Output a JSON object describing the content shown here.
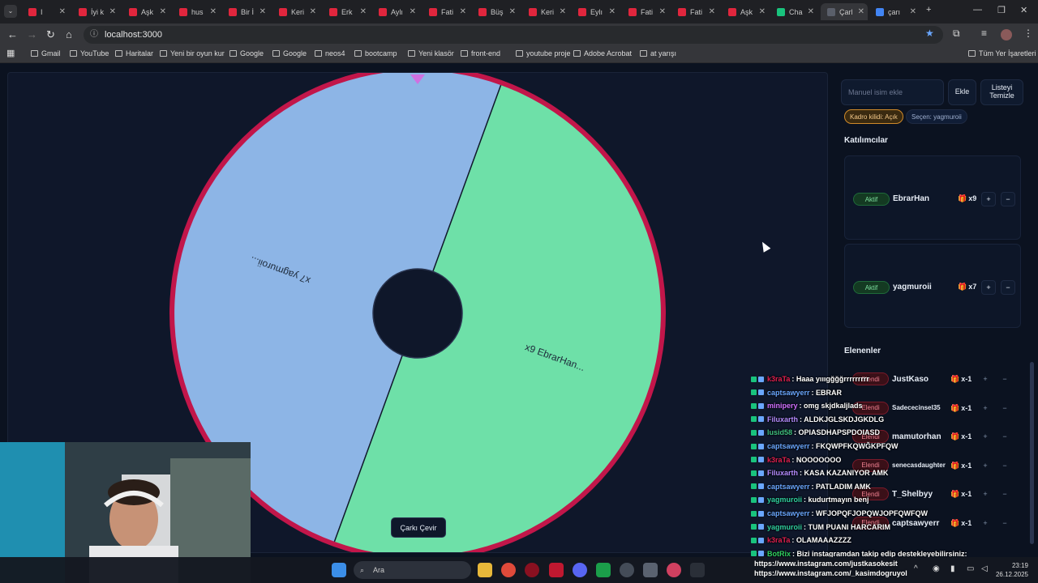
{
  "browser": {
    "tabs": [
      {
        "label": "I",
        "fav": "#e0263d"
      },
      {
        "label": "İyi k",
        "fav": "#e0263d"
      },
      {
        "label": "Aşk",
        "fav": "#e0263d"
      },
      {
        "label": "hus",
        "fav": "#e0263d"
      },
      {
        "label": "Bir İ",
        "fav": "#e0263d"
      },
      {
        "label": "Keri",
        "fav": "#e0263d"
      },
      {
        "label": "Erk",
        "fav": "#e0263d"
      },
      {
        "label": "Aylı",
        "fav": "#e0263d"
      },
      {
        "label": "Fati",
        "fav": "#e0263d"
      },
      {
        "label": "Büş",
        "fav": "#e0263d"
      },
      {
        "label": "Keri",
        "fav": "#e0263d"
      },
      {
        "label": "Eylı",
        "fav": "#e0263d"
      },
      {
        "label": "Fati",
        "fav": "#e0263d"
      },
      {
        "label": "Fati",
        "fav": "#e0263d"
      },
      {
        "label": "Aşk",
        "fav": "#e0263d"
      },
      {
        "label": "Cha",
        "fav": "#19c37d"
      },
      {
        "label": "Çarl",
        "fav": "#5a5f6a"
      },
      {
        "label": "çarı",
        "fav": "#4285f4"
      }
    ],
    "url": "localhost:3000",
    "bookmarks": [
      "Gmail",
      "YouTube",
      "Haritalar",
      "Yeni bir oyun kur",
      "Google",
      "Google",
      "neos4",
      "bootcamp",
      "Yeni klasör",
      "front-end",
      "youtube proje",
      "Adobe Acrobat",
      "at yarışı"
    ],
    "all_bookmarks": "Tüm Yer İşaretleri"
  },
  "wheel": {
    "segments": [
      {
        "label": "x9 EbrarHan...",
        "color": "#6ee0a8"
      },
      {
        "label": "x7 yagmuroii...",
        "color": "#8db5e6"
      }
    ],
    "rim_color": "#c2164a",
    "spin_button": "Çarkı Çevir"
  },
  "panel": {
    "input_placeholder": "Manuel isim ekle",
    "add_button": "Ekle",
    "clear_button": "Listeyi Temizle",
    "lock_chip": "Kadro kilidi: Açık",
    "picker_chip": "Seçen: yagmuroii",
    "participants_title": "Katılımcılar",
    "participants": [
      {
        "status": "Aktif",
        "name": "EbrarHan",
        "multiplier": "x9"
      },
      {
        "status": "Aktif",
        "name": "yagmuroii",
        "multiplier": "x7"
      }
    ],
    "eliminated_title": "Elenenler",
    "eliminated": [
      {
        "status": "Elendi",
        "name": "JustKaso",
        "multiplier": "x-1"
      },
      {
        "status": "Elendi",
        "name": "Sadececinsel35",
        "multiplier": "x-1"
      },
      {
        "status": "Elendi",
        "name": "mamutorhan",
        "multiplier": "x-1"
      },
      {
        "status": "Elendi",
        "name": "senecasdaughter",
        "multiplier": "x-1"
      },
      {
        "status": "Elendi",
        "name": "T_Shelbyy",
        "multiplier": "x-1"
      },
      {
        "status": "Elendi",
        "name": "captsawyerr",
        "multiplier": "x-1"
      }
    ],
    "plus": "+",
    "minus": "−"
  },
  "chat": [
    {
      "user": "k3raTa",
      "color": "#e02050",
      "msg": ": Haaa yıııgğğğrrrrrrrrr"
    },
    {
      "user": "captsawyerr",
      "color": "#6aa7ff",
      "msg": ": EBRAR"
    },
    {
      "user": "minipery",
      "color": "#d070ff",
      "msg": ": omg skjdkaljlads"
    },
    {
      "user": "Filuxarth",
      "color": "#b48cff",
      "msg": ": ALDKJGLSKDJGKDLG"
    },
    {
      "user": "lusid58",
      "color": "#40c080",
      "msg": ": OPIASDHAPSPDOIASD"
    },
    {
      "user": "captsawyerr",
      "color": "#6aa7ff",
      "msg": ": FKQWPFKQWĞKPFQW"
    },
    {
      "user": "k3raTa",
      "color": "#e02050",
      "msg": ": NOOOOOOO"
    },
    {
      "user": "Filuxarth",
      "color": "#b48cff",
      "msg": ": KASA KAZANIYOR AMK"
    },
    {
      "user": "captsawyerr",
      "color": "#6aa7ff",
      "msg": ": PATLADIM AMK"
    },
    {
      "user": "yagmuroii",
      "color": "#30d0a0",
      "msg": ": kudurtmayın benj"
    },
    {
      "user": "captsawyerr",
      "color": "#6aa7ff",
      "msg": ": WFJOPQFJOPQWJOPFQWFQW"
    },
    {
      "user": "yagmuroii",
      "color": "#30d0a0",
      "msg": ": TUM PUANI HARCARIM"
    },
    {
      "user": "k3raTa",
      "color": "#e02050",
      "msg": ": OLAMAAAZZZZ"
    },
    {
      "user": "BotRix",
      "color": "#30d060",
      "msg": ": Bizi instagramdan takip edip destekleyebilirsiniz:"
    }
  ],
  "overlay": {
    "insta1": "https://www.instagram.com/justkasokesit",
    "insta2": "https://www.instagram.com/_kasimdogruyol"
  },
  "taskbar": {
    "search": "Ara",
    "time": "23:19",
    "date": "26.12.2025"
  }
}
